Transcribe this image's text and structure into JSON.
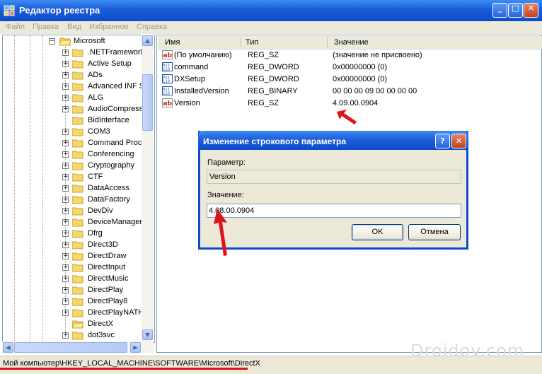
{
  "window": {
    "title": "Редактор реестра"
  },
  "menu": [
    "Файл",
    "Правка",
    "Вид",
    "Избранное",
    "Справка"
  ],
  "tree": {
    "root": "Microsoft",
    "items": [
      ".NETFramework",
      "Active Setup",
      "ADs",
      "Advanced INF S",
      "ALG",
      "AudioCompressi",
      "BidInterface",
      "COM3",
      "Command Proce",
      "Conferencing",
      "Cryptography",
      "CTF",
      "DataAccess",
      "DataFactory",
      "DevDiv",
      "DeviceManager",
      "Dfrg",
      "Direct3D",
      "DirectDraw",
      "DirectInput",
      "DirectMusic",
      "DirectPlay",
      "DirectPlay8",
      "DirectPlayNATHe",
      "DirectX",
      "dot3svc"
    ]
  },
  "list": {
    "columns": [
      "Имя",
      "Тип",
      "Значение"
    ],
    "rows": [
      {
        "icon": "string-value-icon",
        "name": "(По умолчанию)",
        "type": "REG_SZ",
        "value": "(значение не присвоено)"
      },
      {
        "icon": "binary-value-icon",
        "name": "command",
        "type": "REG_DWORD",
        "value": "0x00000000 (0)"
      },
      {
        "icon": "binary-value-icon",
        "name": "DXSetup",
        "type": "REG_DWORD",
        "value": "0x00000000 (0)"
      },
      {
        "icon": "binary-value-icon",
        "name": "InstalledVersion",
        "type": "REG_BINARY",
        "value": "00 00 00 09 00 00 00 00"
      },
      {
        "icon": "string-value-icon",
        "name": "Version",
        "type": "REG_SZ",
        "value": "4.09.00.0904"
      }
    ]
  },
  "dialog": {
    "title": "Изменение строкового параметра",
    "param_label": "Параметр:",
    "param_value": "Version",
    "value_label": "Значение:",
    "value_input": "4.08.00.0904",
    "ok": "OK",
    "cancel": "Отмена"
  },
  "status": {
    "path": "Мой компьютер\\HKEY_LOCAL_MACHINE\\SOFTWARE\\Microsoft\\DirectX"
  },
  "watermark": "Droidov.com",
  "colors": {
    "accent": "#0a4ccc",
    "annotation": "#e0131c"
  }
}
